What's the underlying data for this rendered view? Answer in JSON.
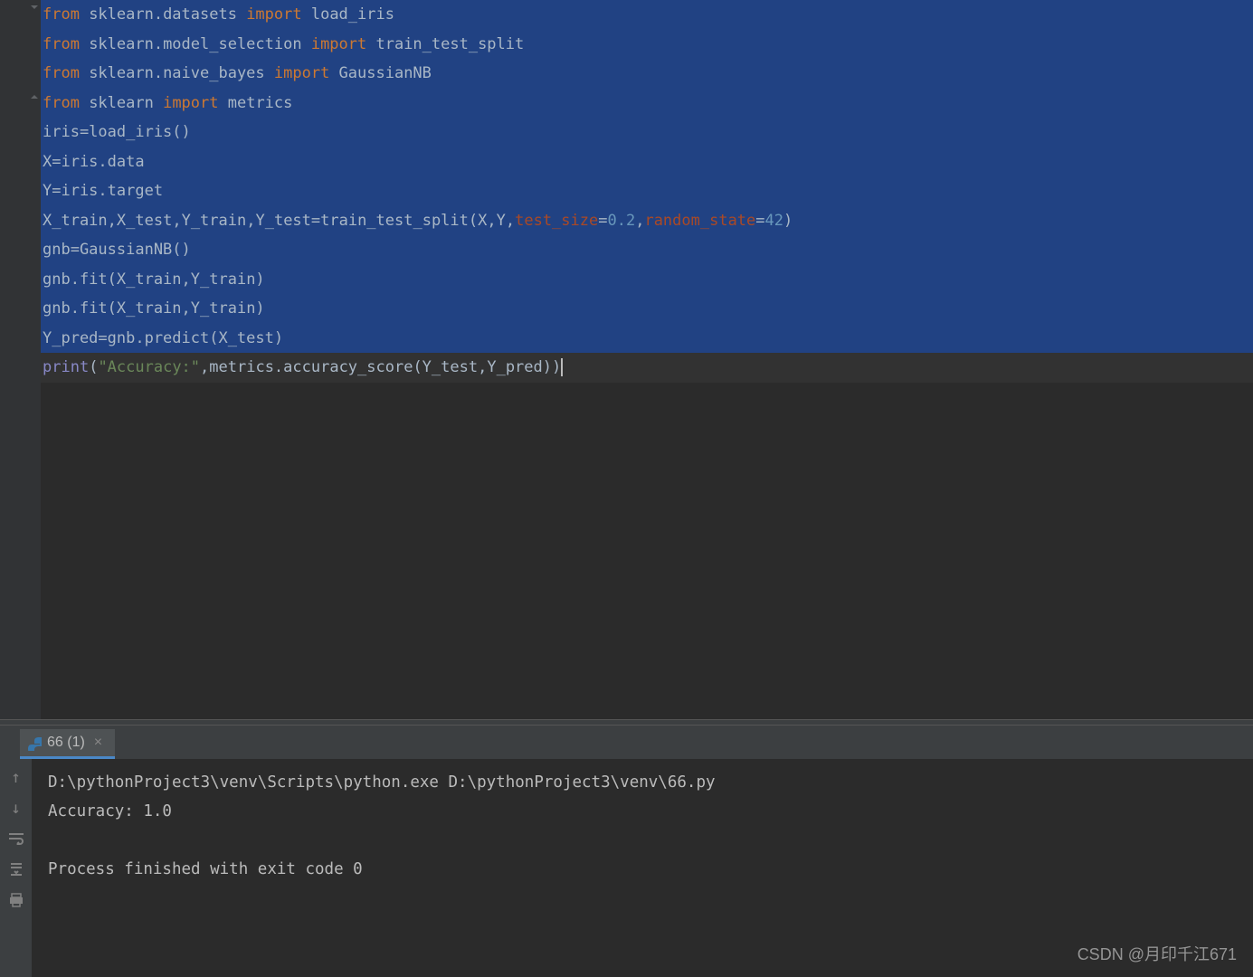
{
  "editor": {
    "lines": [
      {
        "selected": true,
        "tokens": [
          {
            "c": "kw-from",
            "t": "from"
          },
          {
            "c": "ident",
            "t": " sklearn.datasets "
          },
          {
            "c": "kw-import",
            "t": "import"
          },
          {
            "c": "ident",
            "t": " load_iris"
          }
        ]
      },
      {
        "selected": true,
        "tokens": [
          {
            "c": "kw-from",
            "t": "from"
          },
          {
            "c": "ident",
            "t": " sklearn.model_selection "
          },
          {
            "c": "kw-import",
            "t": "import"
          },
          {
            "c": "ident",
            "t": " train_test_split"
          }
        ]
      },
      {
        "selected": true,
        "tokens": [
          {
            "c": "kw-from",
            "t": "from"
          },
          {
            "c": "ident",
            "t": " sklearn.naive_bayes "
          },
          {
            "c": "kw-import",
            "t": "import"
          },
          {
            "c": "ident",
            "t": " GaussianNB"
          }
        ]
      },
      {
        "selected": true,
        "tokens": [
          {
            "c": "kw-from",
            "t": "from"
          },
          {
            "c": "ident",
            "t": " sklearn "
          },
          {
            "c": "kw-import",
            "t": "import"
          },
          {
            "c": "ident",
            "t": " metrics"
          }
        ]
      },
      {
        "selected": true,
        "tokens": [
          {
            "c": "ident",
            "t": "iris=load_iris()"
          }
        ]
      },
      {
        "selected": true,
        "tokens": [
          {
            "c": "ident",
            "t": "X=iris.data"
          }
        ]
      },
      {
        "selected": true,
        "tokens": [
          {
            "c": "ident",
            "t": "Y=iris.target"
          }
        ]
      },
      {
        "selected": true,
        "tokens": [
          {
            "c": "ident",
            "t": "X_train"
          },
          {
            "c": "op",
            "t": ","
          },
          {
            "c": "ident",
            "t": "X_test"
          },
          {
            "c": "op",
            "t": ","
          },
          {
            "c": "ident",
            "t": "Y_train"
          },
          {
            "c": "op",
            "t": ","
          },
          {
            "c": "ident",
            "t": "Y_test=train_test_split(X"
          },
          {
            "c": "op",
            "t": ","
          },
          {
            "c": "ident",
            "t": "Y"
          },
          {
            "c": "op",
            "t": ","
          },
          {
            "c": "param",
            "t": "test_size"
          },
          {
            "c": "ident",
            "t": "="
          },
          {
            "c": "num",
            "t": "0.2"
          },
          {
            "c": "op",
            "t": ","
          },
          {
            "c": "param",
            "t": "random_state"
          },
          {
            "c": "ident",
            "t": "="
          },
          {
            "c": "num",
            "t": "42"
          },
          {
            "c": "ident",
            "t": ")"
          }
        ]
      },
      {
        "selected": true,
        "tokens": [
          {
            "c": "ident",
            "t": "gnb=GaussianNB()"
          }
        ]
      },
      {
        "selected": true,
        "tokens": [
          {
            "c": "ident",
            "t": "gnb.fit(X_train"
          },
          {
            "c": "op",
            "t": ","
          },
          {
            "c": "ident",
            "t": "Y_train)"
          }
        ]
      },
      {
        "selected": true,
        "tokens": [
          {
            "c": "ident",
            "t": "gnb.fit(X_train"
          },
          {
            "c": "op",
            "t": ","
          },
          {
            "c": "ident",
            "t": "Y_train)"
          }
        ]
      },
      {
        "selected": true,
        "tokens": [
          {
            "c": "ident",
            "t": "Y_pred=gnb.predict(X_test)"
          }
        ]
      },
      {
        "selected": false,
        "current": true,
        "tokens": [
          {
            "c": "builtin",
            "t": "print"
          },
          {
            "c": "ident",
            "t": "("
          },
          {
            "c": "str",
            "t": "\"Accuracy:\""
          },
          {
            "c": "op",
            "t": ","
          },
          {
            "c": "ident",
            "t": "metrics.accuracy_score(Y_test"
          },
          {
            "c": "op",
            "t": ","
          },
          {
            "c": "ident",
            "t": "Y_pred))"
          }
        ]
      }
    ],
    "fold_markers": [
      0,
      3
    ]
  },
  "console": {
    "tab_label": "66 (1)",
    "lines": [
      "D:\\pythonProject3\\venv\\Scripts\\python.exe D:\\pythonProject3\\venv\\66.py",
      "Accuracy: 1.0",
      "",
      "Process finished with exit code 0",
      ""
    ]
  },
  "watermark": "CSDN @月印千江671"
}
